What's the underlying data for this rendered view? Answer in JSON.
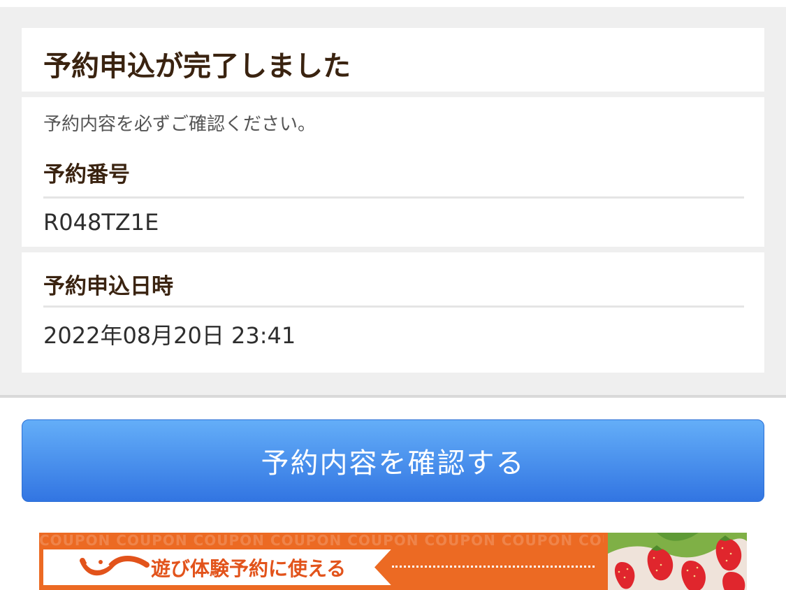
{
  "header": {
    "title": "予約申込が完了しました"
  },
  "details": {
    "notice": "予約内容を必ずご確認ください。",
    "reservation_number_label": "予約番号",
    "reservation_number": "R048TZ1E",
    "application_datetime_label": "予約申込日時",
    "application_datetime": "2022年08月20日 23:41"
  },
  "actions": {
    "confirm_label": "予約内容を確認する"
  },
  "banner": {
    "text": "遊び体験予約に使える",
    "pattern_text": "COUPON",
    "logo_icon": "jalan-wave-logo-icon",
    "photo_icon": "strawberries-photo-icon"
  },
  "colors": {
    "title_text": "#3a2310",
    "button_top": "#64aef8",
    "button_bottom": "#3275e2",
    "banner_orange": "#ec6a23",
    "strawberry_red": "#e0262d"
  }
}
